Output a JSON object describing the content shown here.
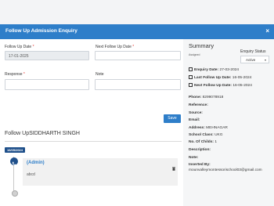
{
  "modal": {
    "title": "Follow Up Admission Enquiry",
    "close": "×"
  },
  "form": {
    "follow_up_date_label": "Follow Up Date",
    "follow_up_date_value": "17-01-2025",
    "next_follow_up_date_label": "Next Follow Up Date",
    "next_follow_up_date_value": "",
    "response_label": "Response",
    "response_value": "",
    "note_label": "Note",
    "note_value": "",
    "required_mark": "*",
    "save_label": "Save"
  },
  "history": {
    "title": "Follow UpSIDDHARTH SINGH",
    "date_badge": "16/05/2024",
    "author": "(Admin)",
    "text": "abcd"
  },
  "summary": {
    "title": "Summary",
    "assigned_label": "Assigned",
    "enquiry_status_label": "Enquiry Status",
    "enquiry_status_value": "Active",
    "enquiry_date_label": "Enquiry Date:",
    "enquiry_date_value": "27-03-2024",
    "last_follow_up_label": "Last Follow Up Date:",
    "last_follow_up_value": "16-05-2024",
    "next_follow_up_label": "Next Follow Up Date:",
    "next_follow_up_value": "16-05-2024",
    "phone_label": "Phone:",
    "phone_value": "8299078918",
    "reference_label": "Reference:",
    "source_label": "Source:",
    "email_label": "Email:",
    "address_label": "Address:",
    "address_value": "MEHNAGAR",
    "school_class_label": "School Class:",
    "school_class_value": "UKG",
    "no_of_childs_label": "No. Of Childs:",
    "no_of_childs_value": "1",
    "description_label": "Description:",
    "note_label": "Note:",
    "inserted_by_label": "Inserted By:",
    "inserted_by_value": "mounvalleymontessorischool03@gmail.com"
  },
  "colors": {
    "accent": "#2e7ec9",
    "badge": "#1e4f8a",
    "required": "#e53935"
  }
}
